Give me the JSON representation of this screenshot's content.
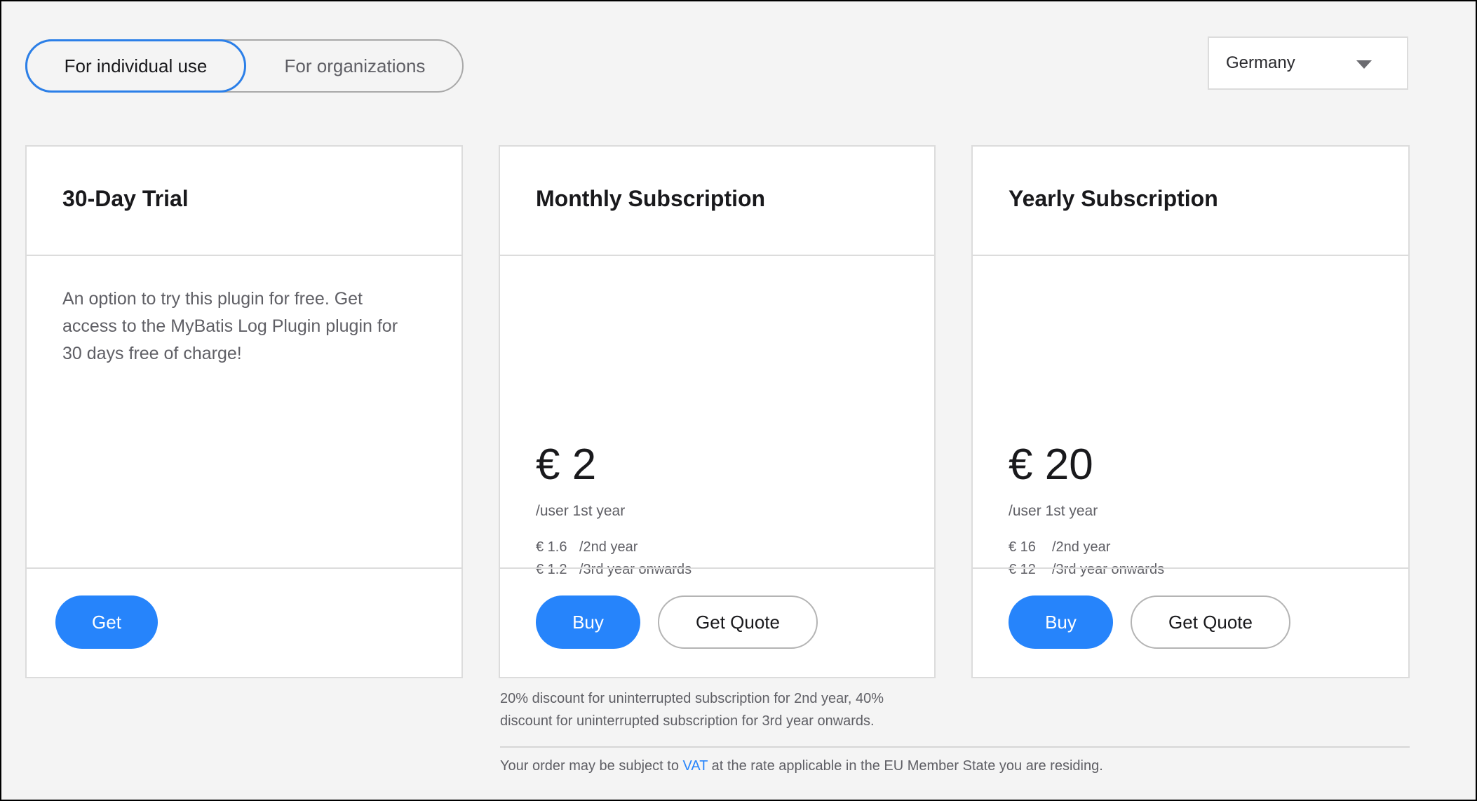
{
  "toggle": {
    "options": [
      {
        "label": "For individual use",
        "active": true
      },
      {
        "label": "For organizations",
        "active": false
      }
    ]
  },
  "country_select": {
    "value": "Germany",
    "icon": "caret-down-icon"
  },
  "cards": [
    {
      "title": "30-Day Trial",
      "description": "An option to try this plugin for free. Get access to the MyBatis Log Plugin plugin for 30 days free of charge!",
      "buttons": [
        {
          "label": "Get",
          "style": "primary"
        }
      ]
    },
    {
      "title": "Monthly Subscription",
      "price": "€ 2",
      "price_unit": "/user 1st year",
      "tiers": [
        {
          "amount": "€ 1.6",
          "period": "/2nd year"
        },
        {
          "amount": "€ 1.2",
          "period": "/3rd year onwards"
        }
      ],
      "buttons": [
        {
          "label": "Buy",
          "style": "primary"
        },
        {
          "label": "Get Quote",
          "style": "secondary"
        }
      ]
    },
    {
      "title": "Yearly Subscription",
      "price": "€ 20",
      "price_unit": "/user 1st year",
      "tiers": [
        {
          "amount": "€ 16",
          "period": "/2nd year"
        },
        {
          "amount": "€ 12",
          "period": "/3rd year onwards"
        }
      ],
      "buttons": [
        {
          "label": "Buy",
          "style": "primary"
        },
        {
          "label": "Get Quote",
          "style": "secondary"
        }
      ]
    }
  ],
  "notes": {
    "discount_line1": "20% discount for uninterrupted subscription for 2nd year, 40%",
    "discount_line2": "discount for uninterrupted subscription for 3rd year onwards.",
    "vat_prefix": "Your order may be subject to ",
    "vat_link": "VAT",
    "vat_suffix": " at the rate applicable in the EU Member State you are residing."
  },
  "colors": {
    "accent": "#2684fb",
    "background": "#f4f4f4",
    "border": "#dcdcdc"
  }
}
